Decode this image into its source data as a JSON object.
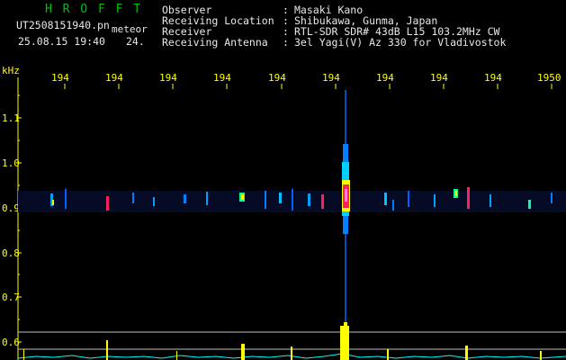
{
  "header": {
    "logo": "H R O F F T",
    "filename": "UT2508151940.pn",
    "filename_suffix": "meteor",
    "datetime": "25.08.15 19:40",
    "count": "24.",
    "labels": [
      "Observer",
      "Receiving Location",
      "Receiver",
      "Receiving Antenna"
    ],
    "separators": [
      ":",
      ":",
      ":",
      ":"
    ],
    "values": [
      "Masaki Kano",
      "Shibukawa, Gunma, Japan",
      "RTL-SDR SDR# 43dB L15 103.2MHz CW",
      "3el Yagi(V) Az 330 for Vladivostok"
    ]
  },
  "axes": {
    "y_unit": "kHz",
    "y_ticks": [
      "1.1",
      "1.0",
      "0.9",
      "0.8",
      "0.7",
      "0.6"
    ],
    "x_ticks": [
      "194",
      "194",
      "194",
      "194",
      "194",
      "194",
      "194",
      "194",
      "194",
      "1950"
    ]
  },
  "colors": {
    "axis": "#ffff00",
    "grid": "#ffffff",
    "signal_hot": "#ff2060",
    "signal_warm": "#ffff00",
    "signal_cool": "#00a0ff",
    "spectrum": "#00ffff"
  }
}
